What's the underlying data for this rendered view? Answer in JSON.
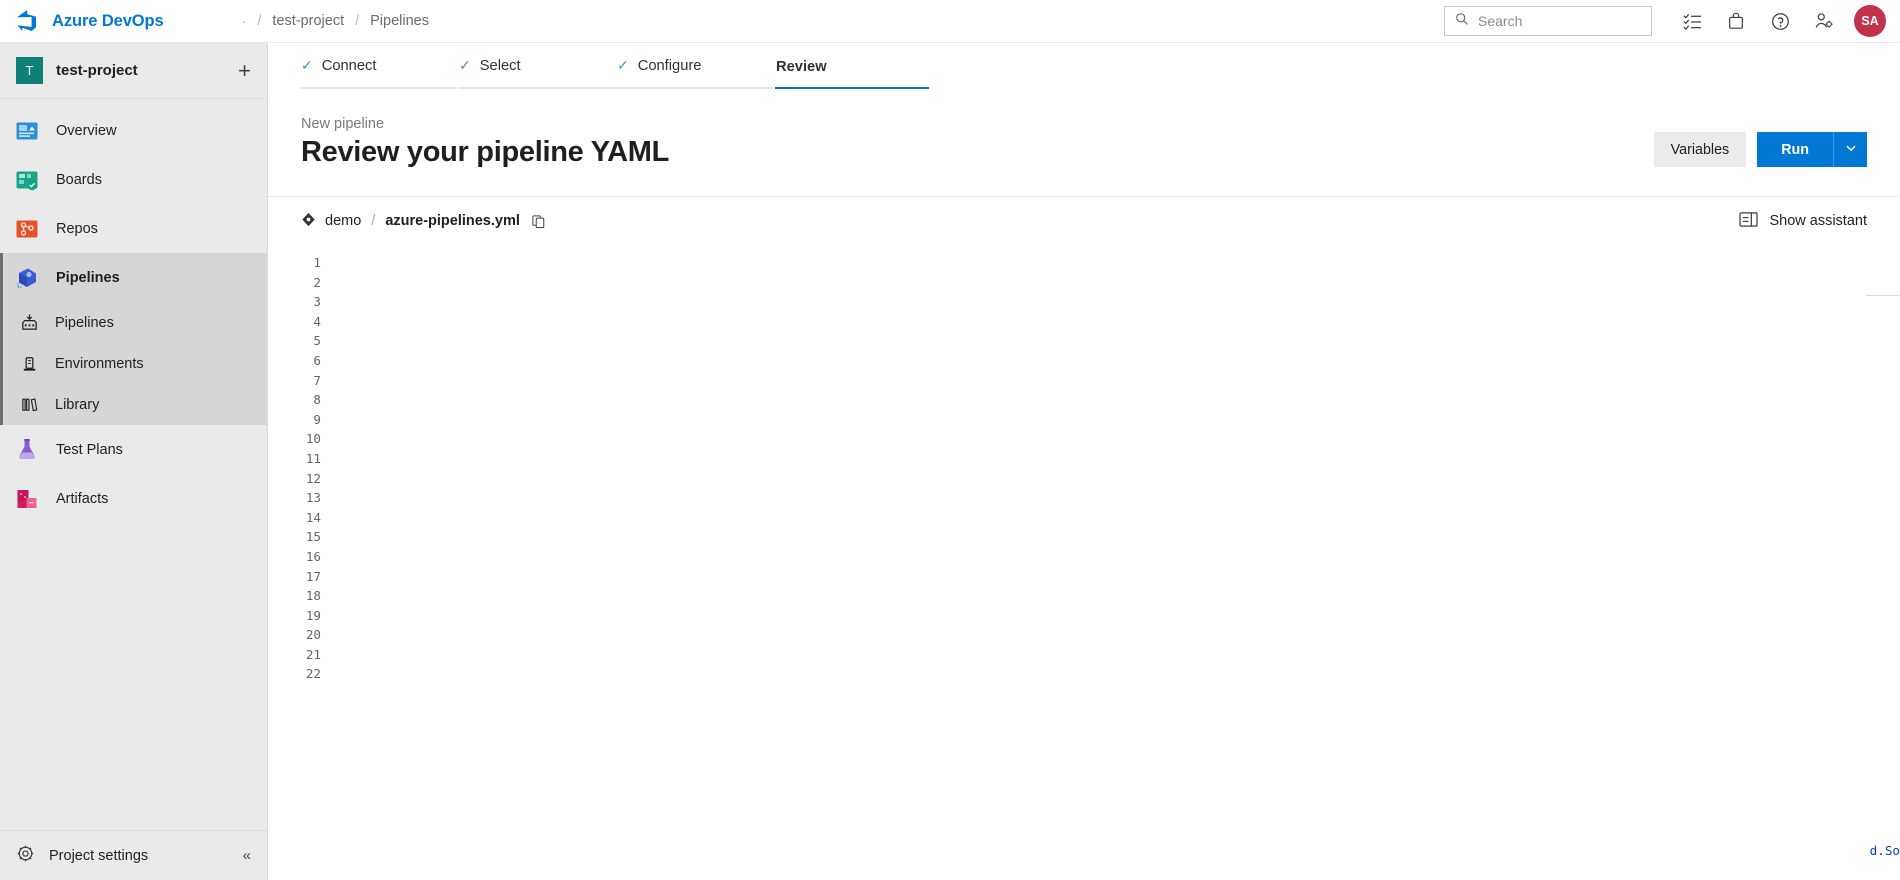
{
  "header": {
    "brand": "Azure DevOps",
    "brand_icon": "azure-devops-logo",
    "breadcrumb": {
      "org": "·",
      "separator": "/",
      "project": "test-project",
      "section": "Pipelines"
    },
    "search": {
      "placeholder": "Search",
      "icon": "search-icon"
    },
    "actions": [
      {
        "name": "boards-tasks-icon",
        "glyph": "checklist"
      },
      {
        "name": "marketplace-icon",
        "glyph": "bag"
      },
      {
        "name": "help-icon",
        "glyph": "question"
      },
      {
        "name": "user-settings-icon",
        "glyph": "person-gear"
      }
    ],
    "avatar": {
      "initials": "SA",
      "color": "#c4314b"
    }
  },
  "sidebar": {
    "project": {
      "initial": "T",
      "name": "test-project",
      "add_label": "+",
      "avatar_color": "#0e8174"
    },
    "items": [
      {
        "label": "Overview",
        "icon": "overview-icon",
        "active": false
      },
      {
        "label": "Boards",
        "icon": "boards-icon",
        "active": false
      },
      {
        "label": "Repos",
        "icon": "repos-icon",
        "active": false
      },
      {
        "label": "Pipelines",
        "icon": "pipelines-icon",
        "active": true
      },
      {
        "label": "Test Plans",
        "icon": "test-plans-icon",
        "active": false
      },
      {
        "label": "Artifacts",
        "icon": "artifacts-icon",
        "active": false
      }
    ],
    "subitems": [
      {
        "label": "Pipelines",
        "icon": "pipelines-sub-icon"
      },
      {
        "label": "Environments",
        "icon": "environments-icon"
      },
      {
        "label": "Library",
        "icon": "library-icon"
      }
    ],
    "footer": {
      "label": "Project settings",
      "icon": "gear-icon",
      "collapse_icon": "chevron-double-left"
    }
  },
  "wizard": {
    "tabs": [
      {
        "label": "Connect",
        "state": "done",
        "check": "✓"
      },
      {
        "label": "Select",
        "state": "done",
        "check": "✓"
      },
      {
        "label": "Configure",
        "state": "done",
        "check": "✓"
      },
      {
        "label": "Review",
        "state": "current",
        "check": ""
      }
    ]
  },
  "page": {
    "eyebrow": "New pipeline",
    "title": "Review your pipeline YAML",
    "variables_button": "Variables",
    "run_button": "Run",
    "run_caret_icon": "chevron-down-icon"
  },
  "editor": {
    "repo_icon": "git-repo-icon",
    "repo": "demo",
    "separator": "/",
    "filename": "azure-pipelines.yml",
    "copy_icon": "copy-icon",
    "assistant_icon": "panel-right-icon",
    "assistant_label": "Show assistant",
    "line_numbers": [
      1,
      2,
      3,
      4,
      5,
      6,
      7,
      8,
      9,
      10,
      11,
      12,
      13,
      14,
      15,
      16,
      17,
      18,
      19,
      20,
      21,
      22
    ],
    "code_lines": [
      "",
      "",
      "",
      "",
      "",
      "",
      "",
      "",
      "",
      "",
      "",
      "",
      "",
      "",
      "",
      "",
      "",
      "",
      "",
      "",
      "",
      ""
    ],
    "ghost_fragment": "d.So"
  },
  "colors": {
    "accent": "#0078d4",
    "sidebar_bg": "#eaeaea",
    "sidebar_active": "#d6d6d6",
    "project_avatar": "#0e8174",
    "user_avatar": "#c4314b",
    "tab_rail": "#e6e6e6"
  }
}
